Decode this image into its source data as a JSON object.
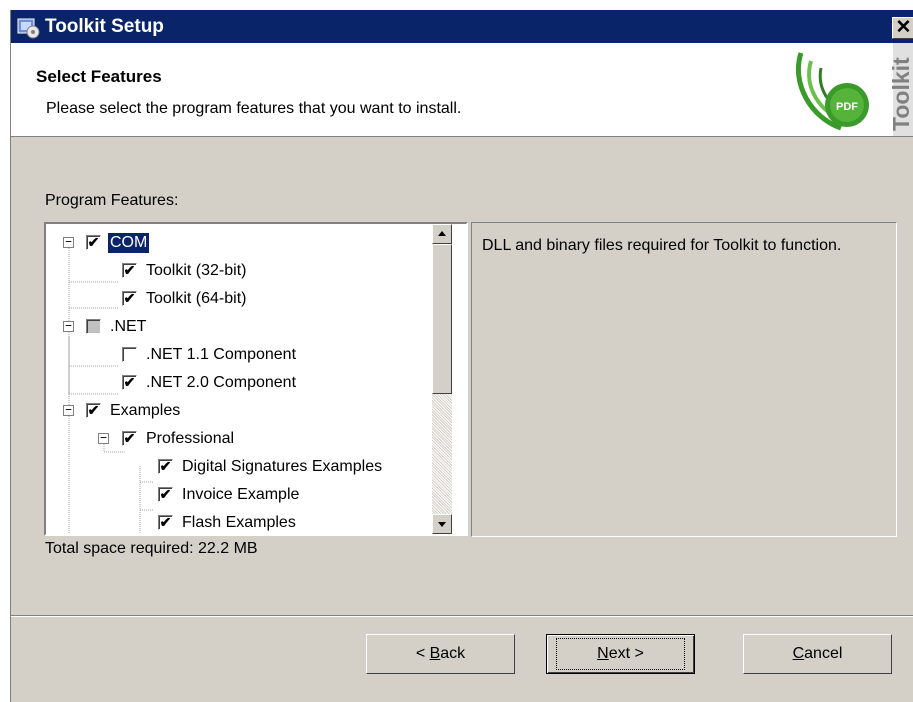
{
  "window": {
    "title": "Toolkit Setup",
    "close_glyph": "✕"
  },
  "header": {
    "title": "Select Features",
    "subtitle": "Please select the program features that you want to install.",
    "logo_text": "Toolkit",
    "logo_badge": "PDF"
  },
  "features": {
    "label": "Program Features:",
    "items": [
      {
        "label": "COM",
        "checked": true,
        "expanded": true,
        "selected": true
      },
      {
        "label": "Toolkit (32-bit)",
        "checked": true
      },
      {
        "label": "Toolkit (64-bit)",
        "checked": true
      },
      {
        "label": ".NET",
        "checked": false,
        "partial": true,
        "expanded": true
      },
      {
        "label": ".NET 1.1 Component",
        "checked": false
      },
      {
        "label": ".NET 2.0 Component",
        "checked": true
      },
      {
        "label": "Examples",
        "checked": true,
        "expanded": true
      },
      {
        "label": "Professional",
        "checked": true,
        "expanded": true
      },
      {
        "label": "Digital Signatures Examples",
        "checked": true
      },
      {
        "label": "Invoice Example",
        "checked": true
      },
      {
        "label": "Flash Examples",
        "checked": true
      }
    ]
  },
  "description": "DLL and binary files required for Toolkit to function.",
  "space_required": "Total space required: 22.2 MB",
  "buttons": {
    "back": {
      "prefix": "< ",
      "accel": "B",
      "rest": "ack"
    },
    "next": {
      "prefix": "",
      "accel": "N",
      "rest": "ext >"
    },
    "cancel": {
      "prefix": "",
      "accel": "C",
      "rest": "ancel"
    }
  },
  "colors": {
    "title_bar": "#0a246a",
    "dialog_face": "#d4d0c8",
    "selection": "#0a246a",
    "logo_green": "#3a9a2a"
  }
}
